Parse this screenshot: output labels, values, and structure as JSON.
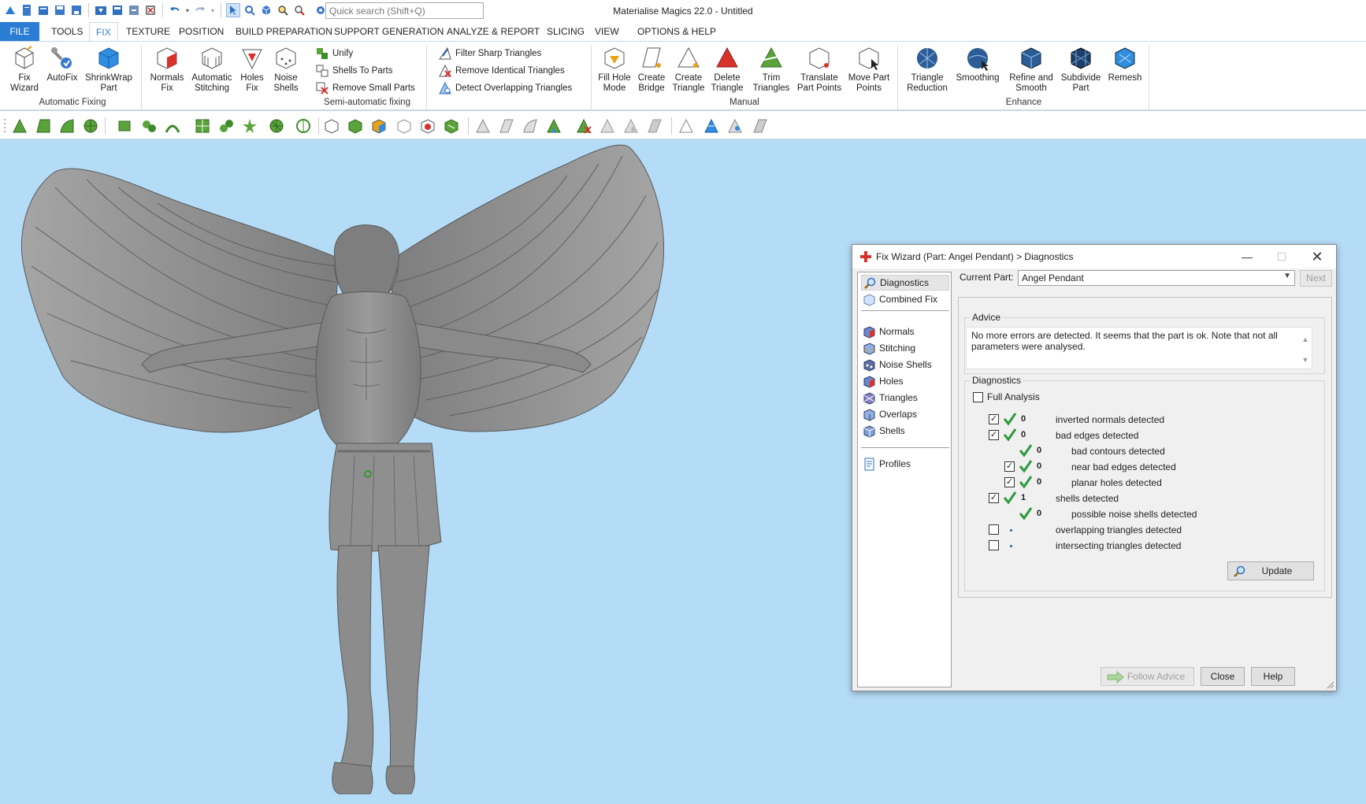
{
  "app": {
    "title": "Materialise Magics 22.0 - Untitled",
    "quick_search_placeholder": "Quick search (Shift+Q)"
  },
  "ribbon_tabs": [
    "FILE",
    "TOOLS",
    "FIX",
    "TEXTURE",
    "POSITION",
    "BUILD PREPARATION",
    "SUPPORT GENERATION",
    "ANALYZE & REPORT",
    "SLICING",
    "VIEW",
    "OPTIONS & HELP"
  ],
  "active_tab": "FIX",
  "ribbon": {
    "automatic_fixing": {
      "label": "Automatic Fixing",
      "buttons": [
        {
          "line1": "Fix",
          "line2": "Wizard",
          "icon": "fix-wizard-icon"
        },
        {
          "line1": "AutoFix",
          "line2": "",
          "icon": "autofix-icon"
        },
        {
          "line1": "ShrinkWrap",
          "line2": "Part",
          "icon": "shrinkwrap-icon"
        }
      ]
    },
    "semi_automatic_fixing": {
      "label": "Semi-automatic fixing",
      "buttons": [
        {
          "line1": "Normals",
          "line2": "Fix",
          "icon": "normals-fix-icon"
        },
        {
          "line1": "Automatic",
          "line2": "Stitching",
          "icon": "stitching-icon"
        },
        {
          "line1": "Holes",
          "line2": "Fix",
          "icon": "holes-fix-icon"
        },
        {
          "line1": "Noise",
          "line2": "Shells",
          "icon": "noise-shells-icon"
        }
      ],
      "small_col1": [
        "Unify",
        "Shells To Parts",
        "Remove Small Parts"
      ],
      "small_col2": [
        "Filter Sharp Triangles",
        "Remove Identical Triangles",
        "Detect Overlapping Triangles"
      ]
    },
    "manual": {
      "label": "Manual",
      "buttons": [
        {
          "line1": "Fill Hole",
          "line2": "Mode",
          "icon": "fill-hole-icon"
        },
        {
          "line1": "Create",
          "line2": "Bridge",
          "icon": "bridge-icon"
        },
        {
          "line1": "Create",
          "line2": "Triangle",
          "icon": "create-triangle-icon"
        },
        {
          "line1": "Delete",
          "line2": "Triangle",
          "icon": "delete-triangle-icon"
        },
        {
          "line1": "Trim",
          "line2": "Triangles",
          "icon": "trim-triangles-icon"
        },
        {
          "line1": "Translate",
          "line2": "Part Points",
          "icon": "translate-points-icon"
        },
        {
          "line1": "Move Part",
          "line2": "Points",
          "icon": "move-points-icon"
        }
      ]
    },
    "enhance": {
      "label": "Enhance",
      "buttons": [
        {
          "line1": "Triangle",
          "line2": "Reduction",
          "icon": "triangle-reduction-icon"
        },
        {
          "line1": "Smoothing",
          "line2": "",
          "icon": "smoothing-icon"
        },
        {
          "line1": "Refine and",
          "line2": "Smooth",
          "icon": "refine-smooth-icon"
        },
        {
          "line1": "Subdivide",
          "line2": "Part",
          "icon": "subdivide-icon"
        },
        {
          "line1": "Remesh",
          "line2": "",
          "icon": "remesh-icon"
        }
      ]
    }
  },
  "dialog": {
    "title": "Fix Wizard (Part: Angel Pendant) > Diagnostics",
    "nav": {
      "top": [
        "Diagnostics",
        "Combined Fix"
      ],
      "middle": [
        "Normals",
        "Stitching",
        "Noise Shells",
        "Holes",
        "Triangles",
        "Overlaps",
        "Shells"
      ],
      "bottom": [
        "Profiles"
      ]
    },
    "current_part_label": "Current Part:",
    "current_part_value": "Angel Pendant",
    "next_label": "Next",
    "advice_title": "Advice",
    "advice_text": "No more errors are detected. It seems that the part is ok. Note that not all parameters were analysed.",
    "diagnostics_title": "Diagnostics",
    "full_analysis_label": "Full Analysis",
    "rows": [
      {
        "label": "inverted normals detected",
        "count": "0"
      },
      {
        "label": "bad edges detected",
        "count": "0"
      },
      {
        "label": "bad contours detected",
        "count": "0"
      },
      {
        "label": "near bad edges detected",
        "count": "0"
      },
      {
        "label": "planar holes detected",
        "count": "0"
      },
      {
        "label": "shells detected",
        "count": "1"
      },
      {
        "label": "possible noise shells detected",
        "count": "0"
      },
      {
        "label": "overlapping triangles detected",
        "count": ""
      },
      {
        "label": "intersecting triangles detected",
        "count": ""
      }
    ],
    "update_label": "Update",
    "follow_advice_label": "Follow Advice",
    "close_label": "Close",
    "help_label": "Help"
  },
  "colors": {
    "accent": "#2b7cd3",
    "viewport_bg": "#b5dcf7",
    "check_green": "#2e9a3a",
    "model_grey": "#8c8c8c"
  }
}
